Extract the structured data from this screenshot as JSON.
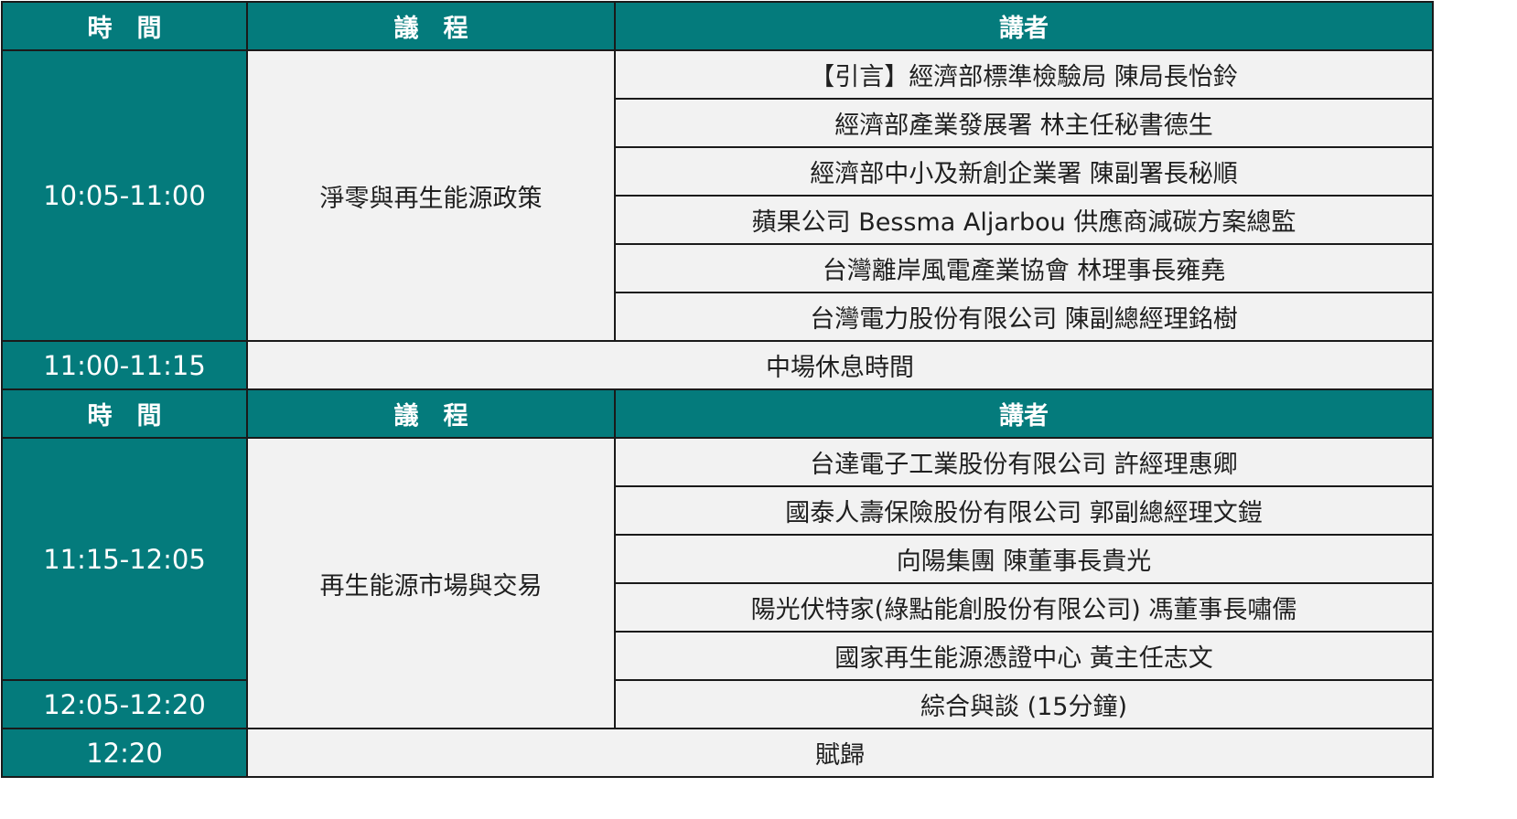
{
  "header_labels": {
    "time": "時　間",
    "agenda": "議　程",
    "speaker": "講者"
  },
  "sessions": [
    {
      "time": "10:05-11:00",
      "topic": "淨零與再生能源政策",
      "speakers": [
        "【引言】經濟部標準檢驗局 陳局長怡鈴",
        "經濟部產業發展署 林主任秘書德生",
        "經濟部中小及新創企業署 陳副署長秘順",
        "蘋果公司 Bessma Aljarbou 供應商減碳方案總監",
        "台灣離岸風電產業協會 林理事長雍堯",
        "台灣電力股份有限公司 陳副總經理銘樹"
      ]
    },
    {
      "time": "11:15-12:05",
      "topic": "再生能源市場與交易",
      "speakers": [
        "台達電子工業股份有限公司 許經理惠卿",
        "國泰人壽保險股份有限公司 郭副總經理文鎧",
        "向陽集團 陳董事長貴光",
        "陽光伏特家(綠點能創股份有限公司) 馮董事長嘯儒",
        "國家再生能源憑證中心 黃主任志文"
      ]
    }
  ],
  "break": {
    "time": "11:00-11:15",
    "label": "中場休息時間"
  },
  "discussion": {
    "time": "12:05-12:20",
    "label": "綜合與談 (15分鐘)"
  },
  "closing": {
    "time": "12:20",
    "label": "賦歸"
  }
}
